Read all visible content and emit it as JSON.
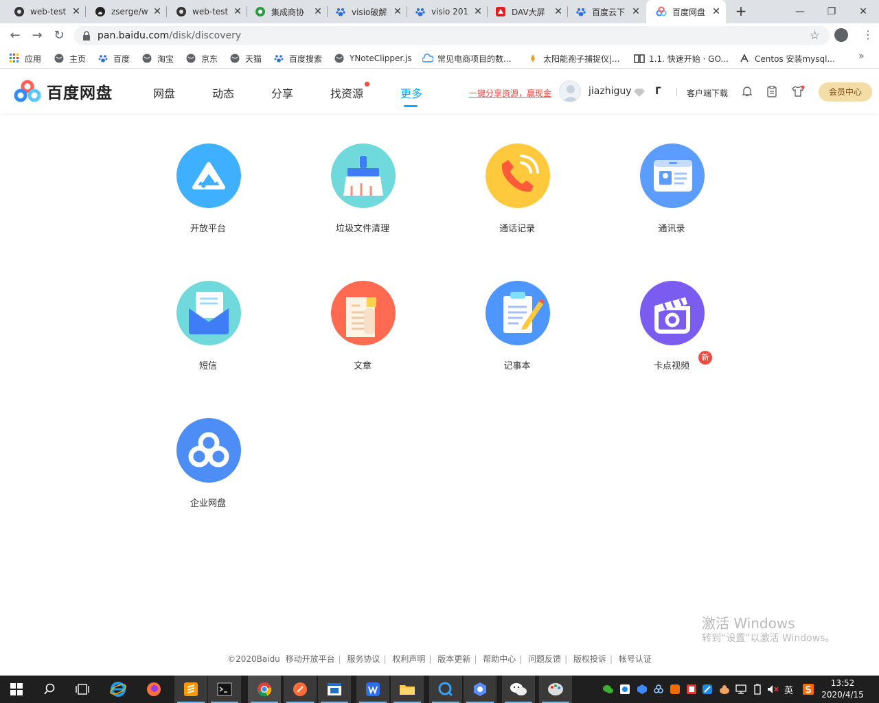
{
  "browser": {
    "tabs": [
      {
        "title": "web-test",
        "icon": "github-icon"
      },
      {
        "title": "zserge/w",
        "icon": "github-icon"
      },
      {
        "title": "web-test",
        "icon": "github-icon"
      },
      {
        "title": "集成商协",
        "icon": "green-circle-icon"
      },
      {
        "title": "visio破解",
        "icon": "baidu-paw-icon"
      },
      {
        "title": "visio 201",
        "icon": "baidu-paw-icon"
      },
      {
        "title": "DAV大屏",
        "icon": "red-logo-icon"
      },
      {
        "title": "百度云下",
        "icon": "baidu-paw-icon"
      },
      {
        "title": "百度网盘",
        "icon": "baidu-netdisk-icon",
        "active": true
      }
    ],
    "new_tab": "+",
    "url_host": "pan.baidu.com",
    "url_path": "/disk/discovery",
    "bookmarks": [
      {
        "label": "应用",
        "icon": "apps-grid-icon"
      },
      {
        "label": "主页",
        "icon": "globe-icon"
      },
      {
        "label": "百度",
        "icon": "baidu-paw-icon"
      },
      {
        "label": "淘宝",
        "icon": "globe-icon"
      },
      {
        "label": "京东",
        "icon": "globe-icon"
      },
      {
        "label": "天猫",
        "icon": "globe-icon"
      },
      {
        "label": "百度搜索",
        "icon": "baidu-paw-icon"
      },
      {
        "label": "YNoteClipper.js",
        "icon": "globe-icon"
      },
      {
        "label": "常见电商项目的数...",
        "icon": "cloud-icon"
      },
      {
        "label": "太阳能孢子捕捉仪|...",
        "icon": "logo-icon"
      },
      {
        "label": "1.1. 快速开始 · GO...",
        "icon": "book-icon"
      },
      {
        "label": "Centos 安装mysql...",
        "icon": "logo-icon"
      }
    ],
    "bookmarks_more": "»"
  },
  "baidu": {
    "logo_text": "百度网盘",
    "nav": [
      "网盘",
      "动态",
      "分享",
      "找资源",
      "更多"
    ],
    "promo": "一键分享资源，赢现金",
    "username": "jiazhiguy",
    "extra": "ᒥ",
    "client_download": "客户端下载",
    "vip": "会员中心"
  },
  "apps": [
    {
      "label": "开放平台",
      "icon": "open-platform-icon",
      "color": "#3fb0ff"
    },
    {
      "label": "垃圾文件清理",
      "icon": "broom-icon",
      "color": "#6fd9dc"
    },
    {
      "label": "通话记录",
      "icon": "phone-icon",
      "color": "#ffc93e"
    },
    {
      "label": "通讯录",
      "icon": "contact-card-icon",
      "color": "#5b9dff"
    },
    {
      "label": "短信",
      "icon": "envelope-icon",
      "color": "#6fd9dc"
    },
    {
      "label": "文章",
      "icon": "article-icon",
      "color": "#ff6a50"
    },
    {
      "label": "记事本",
      "icon": "notepad-icon",
      "color": "#4d96ff"
    },
    {
      "label": "卡点视频",
      "icon": "clapper-icon",
      "color": "#7a5cf0"
    },
    {
      "label": "企业网盘",
      "icon": "enterprise-cloud-icon",
      "color": "#4d8df6"
    }
  ],
  "new_badge": "新",
  "footer": [
    "©2020Baidu",
    "移动开放平台",
    "服务协议",
    "权利声明",
    "版本更新",
    "帮助中心",
    "问题反馈",
    "版权投诉",
    "帐号认证"
  ],
  "watermark": {
    "title": "激活 Windows",
    "subtitle": "转到“设置”以激活 Windows。"
  },
  "taskbar": {
    "lang": "英",
    "time": "13:52",
    "date": "2020/4/15"
  }
}
